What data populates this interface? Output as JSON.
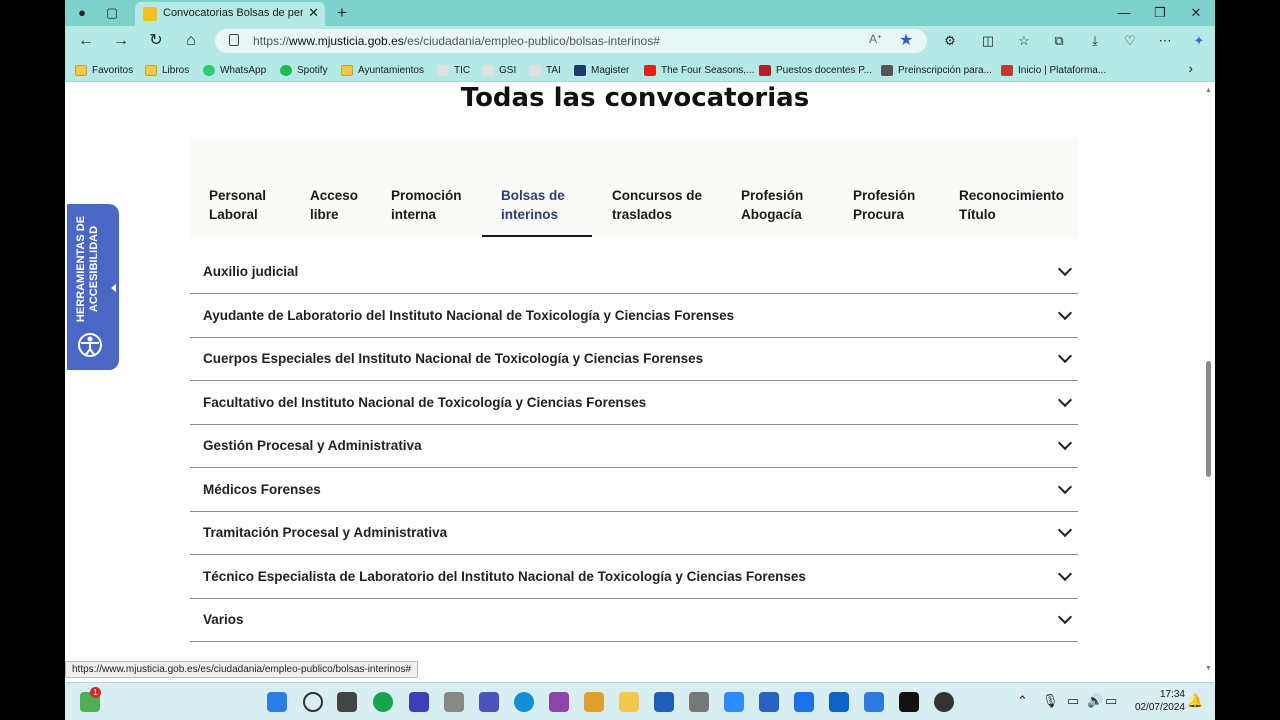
{
  "browser": {
    "tab_title": "Convocatorias Bolsas de persona",
    "url_prefix": "https://",
    "url_domain": "www.mjusticia.gob.es",
    "url_path": "/es/ciudadania/empleo-publico/bolsas-interinos#",
    "status_url": "https://www.mjusticia.gob.es/es/ciudadania/empleo-publico/bolsas-interinos#"
  },
  "bookmarks": [
    {
      "label": "Favoritos",
      "icon": "folder-icon"
    },
    {
      "label": "Libros",
      "icon": "folder-icon"
    },
    {
      "label": "WhatsApp",
      "icon": "whatsapp-icon"
    },
    {
      "label": "Spotify",
      "icon": "spotify-icon"
    },
    {
      "label": "Ayuntamientos",
      "icon": "folder-icon"
    },
    {
      "label": "TIC",
      "icon": "page-icon"
    },
    {
      "label": "GSI",
      "icon": "page-icon"
    },
    {
      "label": "TAI",
      "icon": "page-icon"
    },
    {
      "label": "Magister",
      "icon": "building-icon"
    },
    {
      "label": "The Four Seasons,...",
      "icon": "youtube-icon"
    },
    {
      "label": "Puestos docentes P...",
      "icon": "site-icon"
    },
    {
      "label": "Preinscripción para...",
      "icon": "site-icon"
    },
    {
      "label": "Inicio | Plataforma...",
      "icon": "site-icon"
    }
  ],
  "page": {
    "title": "Todas las convocatorias",
    "category_tabs": [
      {
        "line1": "Personal",
        "line2": "Laboral"
      },
      {
        "line1": "Acceso",
        "line2": "libre"
      },
      {
        "line1": "Promoción",
        "line2": "interna"
      },
      {
        "line1": "Bolsas de",
        "line2": "interinos"
      },
      {
        "line1": "Concursos de",
        "line2": "traslados"
      },
      {
        "line1": "Profesión",
        "line2": "Abogacía"
      },
      {
        "line1": "Profesión",
        "line2": "Procura"
      },
      {
        "line1": "Reconocimiento",
        "line2": "Título"
      }
    ],
    "active_tab": "Bolsas de interinos",
    "accordion_items": [
      "Auxilio judicial",
      "Ayudante de Laboratorio del Instituto Nacional de Toxicología y Ciencias Forenses",
      "Cuerpos Especiales del Instituto Nacional de Toxicología y Ciencias Forenses",
      "Facultativo del Instituto Nacional de Toxicología y Ciencias Forenses",
      "Gestión Procesal y Administrativa",
      "Médicos Forenses",
      "Tramitación Procesal y Administrativa",
      "Técnico Especialista de Laboratorio del Instituto Nacional de Toxicología y Ciencias Forenses",
      "Varios"
    ],
    "accessibility_label": "HERRAMIENTAS DE ACCESIBILIDAD"
  },
  "taskbar": {
    "time": "17:34",
    "date": "02/07/2024",
    "badge": "1"
  }
}
